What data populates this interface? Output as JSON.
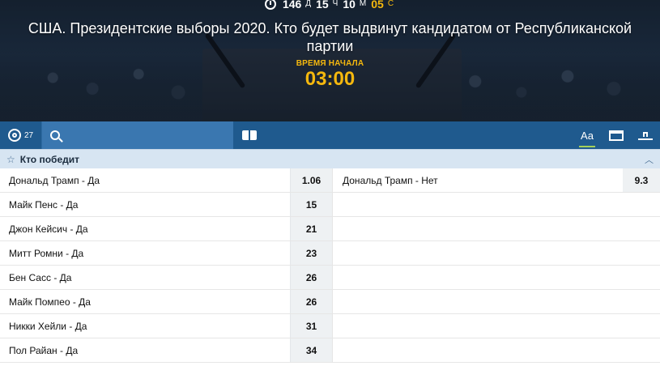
{
  "countdown": {
    "days": "146",
    "days_unit": "Д",
    "hours": "15",
    "hours_unit": "Ч",
    "minutes": "10",
    "minutes_unit": "М",
    "seconds": "05",
    "seconds_unit": "С"
  },
  "event": {
    "title": "США. Президентские выборы 2020. Кто будет выдвинут кандидатом от Республиканской партии",
    "start_label": "ВРЕМЯ НАЧАЛА",
    "start_time": "03:00"
  },
  "toolbar": {
    "market_count": "27",
    "font_toggle_label": "Aa"
  },
  "market": {
    "title": "Кто победит",
    "outcomes": [
      {
        "name": "Дональд Трамп - Да",
        "odds": "1.06"
      },
      {
        "name": "Майк Пенс - Да",
        "odds": "15"
      },
      {
        "name": "Джон Кейсич - Да",
        "odds": "21"
      },
      {
        "name": "Митт Ромни - Да",
        "odds": "23"
      },
      {
        "name": "Бен Сасс - Да",
        "odds": "26"
      },
      {
        "name": "Майк Помпео - Да",
        "odds": "26"
      },
      {
        "name": "Никки Хейли - Да",
        "odds": "31"
      },
      {
        "name": "Пол Райан - Да",
        "odds": "34"
      }
    ],
    "side_outcome": {
      "name": "Дональд Трамп - Нет",
      "odds": "9.3"
    }
  },
  "colors": {
    "accent_yellow": "#f5b80e",
    "toolbar_blue": "#1f5a8e",
    "search_blue": "#3a77b0",
    "header_light": "#d7e5f2",
    "active_green": "#a4d15a"
  },
  "icons": [
    "clock-icon",
    "target-icon",
    "search-icon",
    "book-icon",
    "font-size-icon",
    "window-icon",
    "anchor-icon",
    "star-icon",
    "chevron-up-icon"
  ]
}
